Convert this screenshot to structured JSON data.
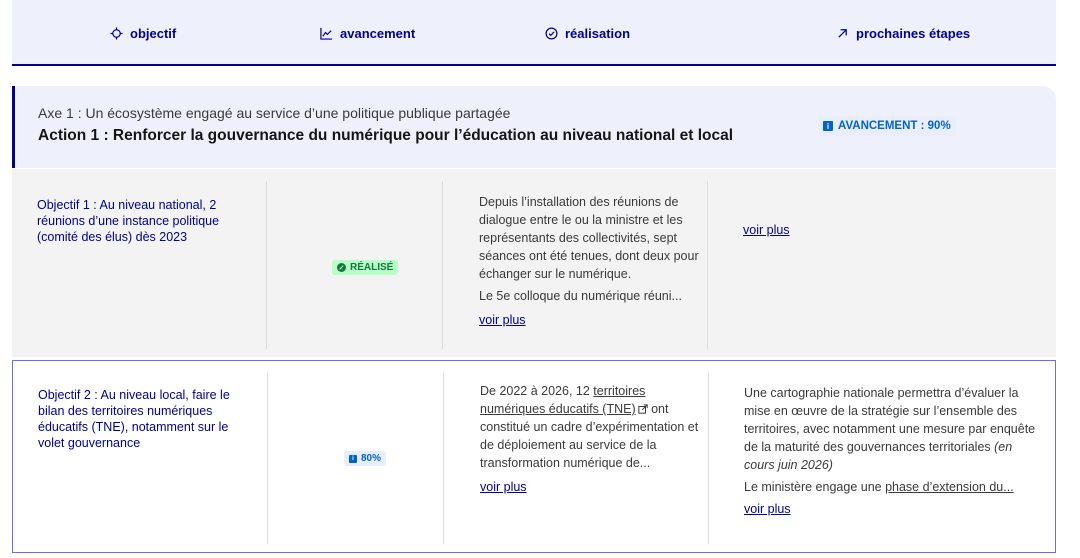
{
  "tabs": [
    {
      "label": "objectif",
      "icon": "target-icon"
    },
    {
      "label": "avancement",
      "icon": "chart-line-icon"
    },
    {
      "label": "réalisation",
      "icon": "check-circle-icon"
    },
    {
      "label": "prochaines étapes",
      "icon": "arrow-up-right-icon"
    }
  ],
  "action": {
    "axe": "Axe 1 : Un écosystème engagé au service d’une politique publique partagée",
    "title": "Action 1 : Renforcer la gouvernance du numérique pour l’éducation au niveau national et local",
    "progress_label": "AVANCEMENT : 90%"
  },
  "rows": [
    {
      "objective": "Objectif 1 : Au niveau national, 2 réunions d’une instance politique (comité des élus) dès 2023",
      "status": "RÉALISÉ",
      "realisation_p1": "Depuis l’installation des réunions de dialogue entre le ou la ministre et les représentants des collectivités, sept séances ont été tenues, dont deux pour échanger sur le numérique.",
      "realisation_p2": "Le 5e colloque du numérique réuni...",
      "realisation_more": "voir plus",
      "next_more": "voir plus"
    },
    {
      "objective": "Objectif 2 : Au niveau local, faire le bilan des territoires numériques éducatifs (TNE), notamment sur le volet gouvernance",
      "status": "80%",
      "realisation_pre": "De 2022 à 2026, 12 ",
      "realisation_link": "territoires numériques éducatifs (TNE)",
      "realisation_post": " ont constitué un cadre d’expérimentation et de déploiement au service de la transformation numérique de...",
      "realisation_more": "voir plus",
      "next_p1": "Une cartographie nationale permettra d’évaluer la mise en œuvre de la stratégie sur l’ensemble des territoires, avec notamment une mesure par enquête de la maturité des gouvernances territoriales ",
      "next_p1_italic": "(en cours juin 2026)",
      "next_p2_pre": "Le ministère engage une ",
      "next_p2_link": "phase d’extension du...",
      "next_more": "voir plus"
    }
  ],
  "colors": {
    "primary": "#000091",
    "success": "#18753c",
    "info": "#0063cb"
  }
}
